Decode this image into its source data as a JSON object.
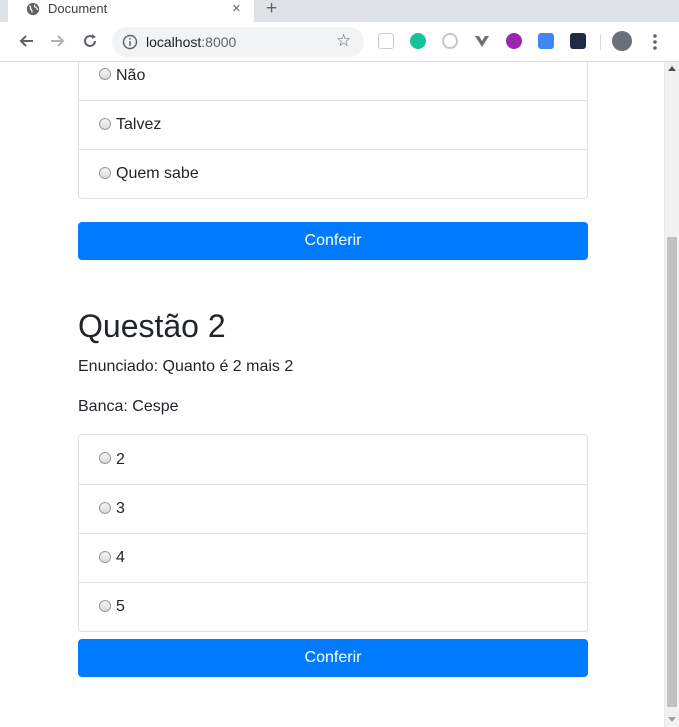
{
  "browser": {
    "tab_title": "Document",
    "tab_close": "×",
    "new_tab": "+",
    "url_host": "localhost",
    "url_port": ":8000",
    "bookmark_icon": "star-outline-icon",
    "extensions": [
      "grid-extension-icon",
      "grammarly-icon",
      "circle-extension-icon",
      "vue-devtools-icon",
      "purple-extension-icon",
      "google-translate-icon",
      "film-extension-icon"
    ]
  },
  "question1": {
    "options": [
      "Não",
      "Talvez",
      "Quem sabe"
    ],
    "button_label": "Conferir"
  },
  "question2": {
    "title": "Questão 2",
    "statement": "Enunciado: Quanto é 2 mais 2",
    "bank": "Banca: Cespe",
    "options": [
      "2",
      "3",
      "4",
      "5"
    ],
    "button_label": "Conferir"
  },
  "colors": {
    "primary": "#007bff",
    "text": "#212529",
    "border": "#dfdfdf"
  }
}
